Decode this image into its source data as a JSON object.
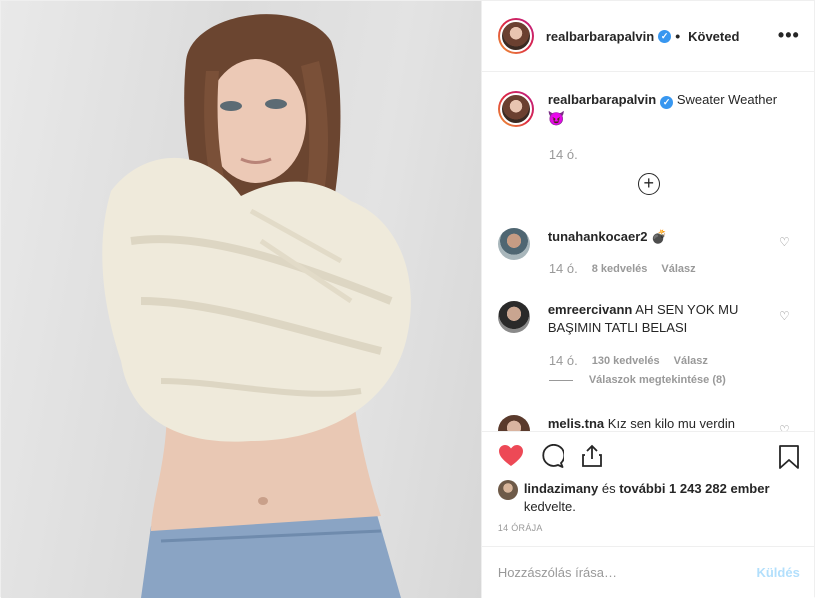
{
  "post": {
    "author": "realbarbarapalvin",
    "follow_status": "Követed",
    "more_icon": "more-horizontal-icon",
    "photo_alt": "photo"
  },
  "caption": {
    "username": "realbarbarapalvin",
    "text": "Sweater Weather",
    "emoji": "😈",
    "time": "14 ó."
  },
  "comments": [
    {
      "username": "tunahankocaer2",
      "text": "💣",
      "time": "14 ó.",
      "likes": "8 kedvelés",
      "reply": "Válasz"
    },
    {
      "username": "emreercivann",
      "text": "AH SEN YOK MU BAŞIMIN TATLI BELASI",
      "time": "14 ó.",
      "likes": "130 kedvelés",
      "reply": "Válasz",
      "view_replies": "Válaszok megtekintése (8)"
    },
    {
      "username": "melis.tna",
      "text": "Kız sen kilo mu verdin"
    }
  ],
  "likes": {
    "user": "lindazimany",
    "middle": " és ",
    "others": "további 1 243 282 ember",
    "suffix": "kedvelte."
  },
  "timestamp": "14 ÓRÁJA",
  "add_comment": {
    "placeholder": "Hozzászólás írása…",
    "send_label": "Küldés"
  },
  "colors": {
    "liked_heart": "#ed4956",
    "verified": "#3897f0",
    "send_disabled": "#b2dffc"
  }
}
